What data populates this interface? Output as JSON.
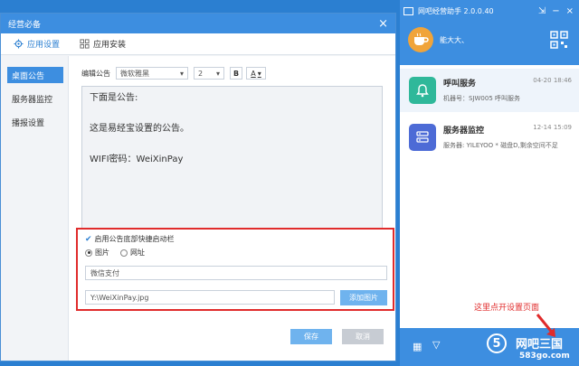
{
  "dialog": {
    "title": "经营必备",
    "tabs": [
      {
        "label": "应用设置",
        "icon": "gear-icon"
      },
      {
        "label": "应用安装",
        "icon": "grid-icon"
      }
    ],
    "sidebar": [
      "桌面公告",
      "服务器监控",
      "播报设置"
    ],
    "toolbar": {
      "label": "编辑公告",
      "font": "微软雅黑",
      "size": "2",
      "bold": "B",
      "color": "A"
    },
    "editor_lines": [
      "下面是公告:",
      "这是易经宝设置的公告。",
      "WIFI密码：WeiXinPay"
    ],
    "checkbox_label": "启用公告底部快捷启动栏",
    "radios": [
      "图片",
      "网址"
    ],
    "name_value": "微信支付",
    "path_value": "Y:\\WeiXinPay.jpg",
    "add_button": "添加图片",
    "save": "保存",
    "cancel": "取消"
  },
  "panel": {
    "title": "网吧经营助手 2.0.0.40",
    "username": "能大大、",
    "items": [
      {
        "title": "呼叫服务",
        "sub": "机器号：SJW005 呼叫服务",
        "time": "04-20 18:46"
      },
      {
        "title": "服务器监控",
        "sub": "服务器: YILEYOO * 磁盘D,剩余空间不足",
        "time": "12-14 15:09"
      }
    ],
    "brand_num": "5",
    "brand_name": "网吧三国",
    "brand_sub": "583go.com"
  },
  "annotation": "这里点开设置页面",
  "colors": {
    "accent": "#3d8ee0",
    "highlight": "#e02b2b"
  }
}
